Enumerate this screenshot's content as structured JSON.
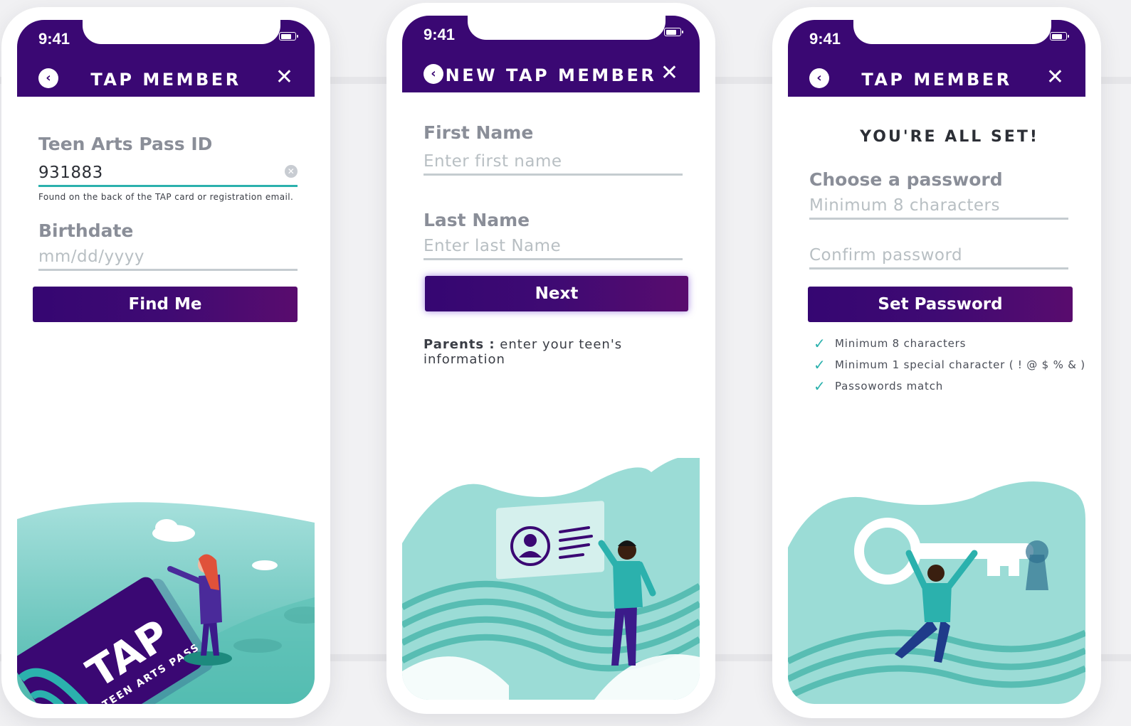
{
  "status": {
    "time": "9:41"
  },
  "screen1": {
    "title": "TAP MEMBER",
    "id_label": "Teen Arts Pass ID",
    "id_value": "931883",
    "id_hint": "Found on the back of the TAP card or registration email.",
    "birth_label": "Birthdate",
    "birth_placeholder": "mm/dd/yyyy",
    "button": "Find Me",
    "card_brand": "TAP",
    "card_subtitle": "TEEN ARTS PASS"
  },
  "screen2": {
    "title": "NEW TAP MEMBER",
    "first_label": "First Name",
    "first_placeholder": "Enter first name",
    "last_label": "Last Name",
    "last_placeholder": "Enter last Name",
    "button": "Next",
    "note_bold": "Parents :",
    "note_text": " enter your teen's information"
  },
  "screen3": {
    "title": "TAP MEMBER",
    "heading": "YOU'RE ALL SET!",
    "password_label": "Choose a password",
    "password_placeholder": "Minimum 8 characters",
    "confirm_placeholder": "Confirm password",
    "button": "Set Password",
    "checks": [
      "Minimum 8 characters",
      "Minimum 1 special character ( ! @ $ % & )",
      "Passowords match"
    ]
  },
  "icons": {
    "back": "chevron-left-icon",
    "close": "close-icon"
  },
  "colors": {
    "brand_purple": "#3a0873",
    "accent_teal": "#2bb1ad",
    "illus_teal": "#8fd6d2"
  }
}
